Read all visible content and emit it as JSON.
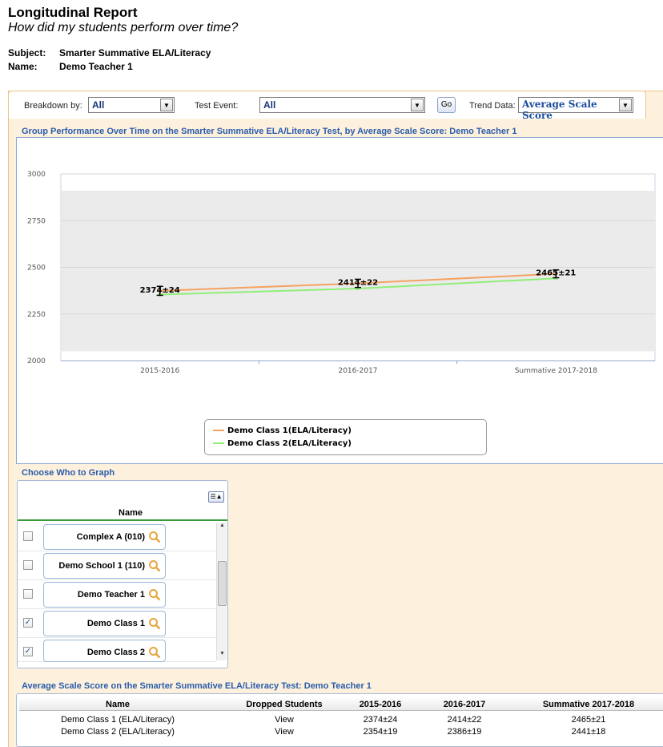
{
  "report": {
    "title": "Longitudinal Report",
    "subtitle": "How did my students perform over time?",
    "subject_label": "Subject:",
    "subject_value": "Smarter Summative ELA/Literacy",
    "name_label": "Name:",
    "name_value": "Demo Teacher 1"
  },
  "controls": {
    "breakdown_label": "Breakdown by:",
    "breakdown_value": "All",
    "test_event_label": "Test Event:",
    "test_event_value": "All",
    "go_label": "Go",
    "trend_label": "Trend Data:",
    "trend_value": "Average Scale Score"
  },
  "chart_section_title": "Group Performance Over Time on the Smarter Summative ELA/Literacy Test, by Average Scale Score: Demo Teacher 1",
  "chart_data": {
    "type": "line",
    "categories": [
      "2015-2016",
      "2016-2017",
      "Summative 2017-2018"
    ],
    "ylim": [
      2000,
      3000
    ],
    "yticks": [
      "3000",
      "2750",
      "2500",
      "2250",
      "2000"
    ],
    "band": [
      2050,
      2910
    ],
    "series": [
      {
        "name": "Demo Class 1(ELA/Literacy)",
        "color": "#f4a261",
        "values": [
          2374,
          2414,
          2465
        ],
        "errors": [
          24,
          22,
          21
        ],
        "labels": [
          "2374±24",
          "2414±22",
          "2465±21"
        ]
      },
      {
        "name": "Demo Class 2(ELA/Literacy)",
        "color": "#90ee78",
        "values": [
          2354,
          2386,
          2441
        ],
        "errors": [
          19,
          19,
          18
        ]
      }
    ]
  },
  "choose_title": "Choose Who to Graph",
  "grid": {
    "header": "Name",
    "rows": [
      {
        "name": "Complex A (010)",
        "checked": false
      },
      {
        "name": "Demo School 1 (110)",
        "checked": false
      },
      {
        "name": "Demo Teacher 1",
        "checked": false
      },
      {
        "name": "Demo Class 1",
        "checked": true
      },
      {
        "name": "Demo Class 2",
        "checked": true
      }
    ]
  },
  "table_title": "Average Scale Score on the Smarter Summative ELA/Literacy Test: Demo Teacher 1",
  "table": {
    "headers": [
      "Name",
      "Dropped Students",
      "2015-2016",
      "2016-2017",
      "Summative 2017-2018"
    ],
    "rows": [
      [
        "Demo Class 1 (ELA/Literacy)",
        "View",
        "2374±24",
        "2414±22",
        "2465±21"
      ],
      [
        "Demo Class 2 (ELA/Literacy)",
        "View",
        "2354±19",
        "2386±19",
        "2441±18"
      ]
    ]
  }
}
